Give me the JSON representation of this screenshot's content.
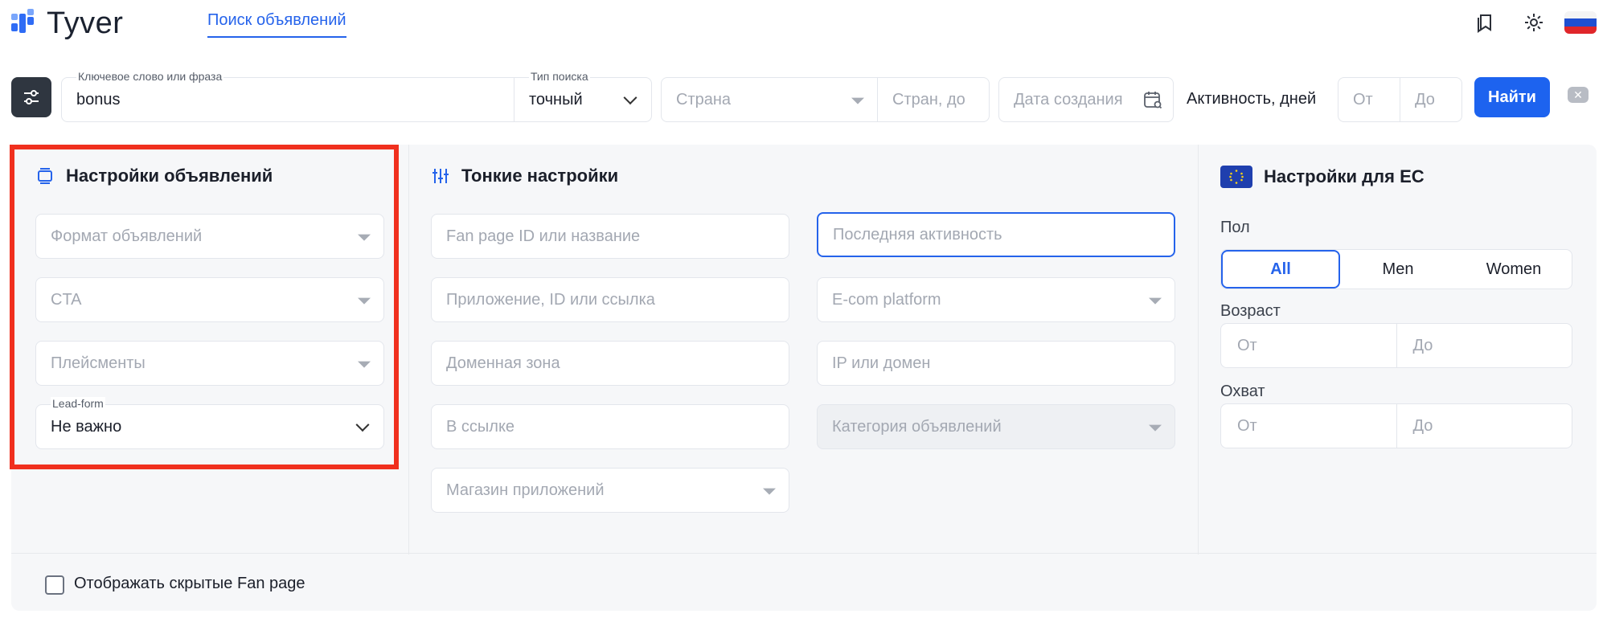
{
  "header": {
    "logo_text": "Tyver",
    "nav_link": "Поиск объявлений"
  },
  "search": {
    "keyword_label": "Ключевое слово или фраза",
    "keyword_value": "bonus",
    "type_label": "Тип поиска",
    "type_value": "точный",
    "country_placeholder": "Страна",
    "country_to_placeholder": "Стран, до",
    "date_placeholder": "Дата создания",
    "activity_label": "Активность, дней",
    "from_placeholder": "От",
    "to_placeholder": "До",
    "find_button": "Найти"
  },
  "ad_settings": {
    "title": "Настройки объявлений",
    "format_placeholder": "Формат объявлений",
    "cta_placeholder": "CTA",
    "placements_placeholder": "Плейсменты",
    "leadform_label": "Lead-form",
    "leadform_value": "Не важно"
  },
  "fine_settings": {
    "title": "Тонкие настройки",
    "fanpage_placeholder": "Fan page ID или название",
    "last_activity_placeholder": "Последняя активность",
    "app_placeholder": "Приложение, ID или ссылка",
    "ecom_placeholder": "E-com platform",
    "domain_zone_placeholder": "Доменная зона",
    "ip_domain_placeholder": "IP или домен",
    "in_link_placeholder": "В ссылке",
    "category_placeholder": "Категория объявлений",
    "app_store_placeholder": "Магазин приложений"
  },
  "eu_settings": {
    "title": "Настройки для ЕС",
    "gender_label": "Пол",
    "gender_options": [
      "All",
      "Men",
      "Women"
    ],
    "gender_selected": "All",
    "age_label": "Возраст",
    "reach_label": "Охват",
    "from_placeholder": "От",
    "to_placeholder": "До"
  },
  "footer": {
    "show_hidden_label": "Отображать скрытые Fan page",
    "show_hidden_checked": false
  },
  "colors": {
    "accent": "#1d63ef",
    "highlight_border": "#f0301e"
  }
}
